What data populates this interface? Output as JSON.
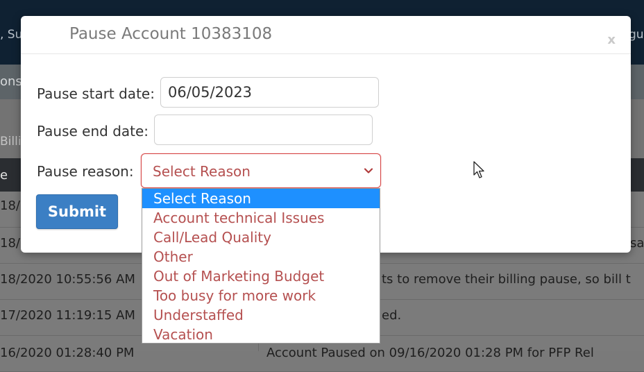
{
  "background": {
    "topbar_left": ", Su",
    "topbar_right": "gu",
    "nav_fragment": "ons",
    "band_fragment": "Billi",
    "header_fragment": "e",
    "rows": [
      {
        "date": "18/",
        "note": ""
      },
      {
        "date": "18/",
        "note": "sa"
      },
      {
        "date": "18/2020 10:55:56 AM",
        "note": "ts to remove their billing pause, so bill t"
      },
      {
        "date": "17/2020 11:19:15 AM",
        "note": "ed."
      },
      {
        "date": "16/2020 01:28:40 PM",
        "note": "Account Paused on 09/16/2020 01:28 PM for PFP Rel"
      }
    ]
  },
  "modal": {
    "title": "Pause Account 10383108",
    "close_label": "x",
    "start_label": "Pause start date:",
    "start_value": "06/05/2023",
    "end_label": "Pause end date:",
    "end_value": "",
    "reason_label": "Pause reason:",
    "reason_value": "Select Reason",
    "submit_label": "Submit"
  },
  "dropdown": {
    "options": [
      "Select Reason",
      "Account technical Issues",
      "Call/Lead Quality",
      "Other",
      "Out of Marketing Budget",
      "Too busy for more work",
      "Understaffed",
      "Vacation"
    ],
    "selected_index": 0
  },
  "colors": {
    "primary_button": "#3b7fc4",
    "option_text": "#b55050",
    "selected_option_bg": "#1e90ff",
    "select_border": "#d64545"
  }
}
